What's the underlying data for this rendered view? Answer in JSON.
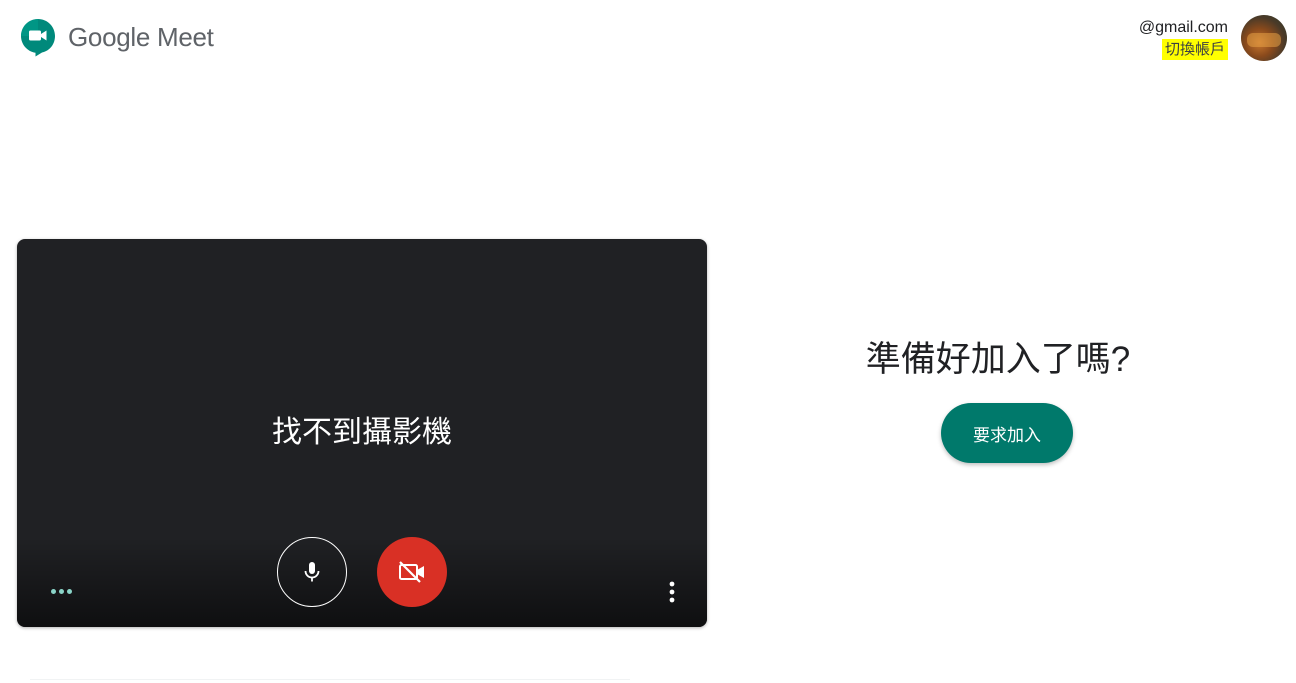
{
  "header": {
    "brand_name": "Google Meet",
    "logo_icon": "google-meet-logo",
    "account_email": "@gmail.com",
    "switch_account_label": "切換帳戶"
  },
  "preview": {
    "camera_message": "找不到攝影機",
    "mic_icon": "microphone-icon",
    "camera_icon": "camera-off-icon",
    "more_icon": "more-vert-icon",
    "audio_indicator_icon": "audio-dots-icon"
  },
  "join_panel": {
    "title": "準備好加入了嗎?",
    "join_button_label": "要求加入"
  },
  "colors": {
    "brand_accent": "#00796b",
    "camera_off_red": "#d93025",
    "preview_background": "#202124",
    "highlight": "#ffff00"
  }
}
